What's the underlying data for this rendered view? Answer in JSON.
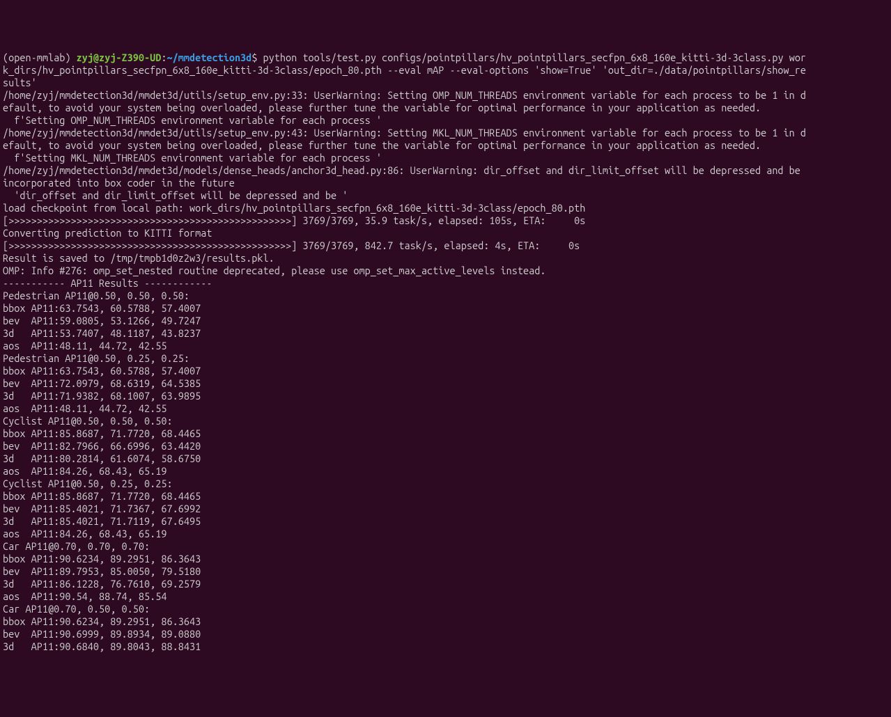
{
  "prompt": {
    "env": "(open-mmlab) ",
    "user": "zyj@zyj-Z390-UD",
    "colon": ":",
    "path": "~/mmdetection3d",
    "dollar": "$"
  },
  "command": " python tools/test.py configs/pointpillars/hv_pointpillars_secfpn_6x8_160e_kitti-3d-3class.py wor",
  "lines": [
    "k_dirs/hv_pointpillars_secfpn_6x8_160e_kitti-3d-3class/epoch_80.pth --eval mAP --eval-options 'show=True' 'out_dir=./data/pointpillars/show_re",
    "sults'",
    "/home/zyj/mmdetection3d/mmdet3d/utils/setup_env.py:33: UserWarning: Setting OMP_NUM_THREADS environment variable for each process to be 1 in d",
    "efault, to avoid your system being overloaded, please further tune the variable for optimal performance in your application as needed.",
    "  f'Setting OMP_NUM_THREADS environment variable for each process '",
    "/home/zyj/mmdetection3d/mmdet3d/utils/setup_env.py:43: UserWarning: Setting MKL_NUM_THREADS environment variable for each process to be 1 in d",
    "efault, to avoid your system being overloaded, please further tune the variable for optimal performance in your application as needed.",
    "  f'Setting MKL_NUM_THREADS environment variable for each process '",
    "/home/zyj/mmdetection3d/mmdet3d/models/dense_heads/anchor3d_head.py:86: UserWarning: dir_offset and dir_limit_offset will be depressed and be ",
    "incorporated into box coder in the future",
    "  'dir_offset and dir_limit_offset will be depressed and be '",
    "load checkpoint from local path: work_dirs/hv_pointpillars_secfpn_6x8_160e_kitti-3d-3class/epoch_80.pth",
    "[>>>>>>>>>>>>>>>>>>>>>>>>>>>>>>>>>>>>>>>>>>>>>>>>>>] 3769/3769, 35.9 task/s, elapsed: 105s, ETA:     0s",
    "Converting prediction to KITTI format",
    "[>>>>>>>>>>>>>>>>>>>>>>>>>>>>>>>>>>>>>>>>>>>>>>>>>>] 3769/3769, 842.7 task/s, elapsed: 4s, ETA:     0s",
    "Result is saved to /tmp/tmpb1d0z2w3/results.pkl.",
    "OMP: Info #276: omp_set_nested routine deprecated, please use omp_set_max_active_levels instead.",
    "",
    "",
    "----------- AP11 Results ------------",
    "",
    "Pedestrian AP11@0.50, 0.50, 0.50:",
    "bbox AP11:63.7543, 60.5788, 57.4007",
    "bev  AP11:59.0805, 53.1266, 49.7247",
    "3d   AP11:53.7407, 48.1187, 43.8237",
    "aos  AP11:48.11, 44.72, 42.55",
    "Pedestrian AP11@0.50, 0.25, 0.25:",
    "bbox AP11:63.7543, 60.5788, 57.4007",
    "bev  AP11:72.0979, 68.6319, 64.5385",
    "3d   AP11:71.9382, 68.1007, 63.9895",
    "aos  AP11:48.11, 44.72, 42.55",
    "Cyclist AP11@0.50, 0.50, 0.50:",
    "bbox AP11:85.8687, 71.7720, 68.4465",
    "bev  AP11:82.7966, 66.6996, 63.4420",
    "3d   AP11:80.2814, 61.6074, 58.6750",
    "aos  AP11:84.26, 68.43, 65.19",
    "Cyclist AP11@0.50, 0.25, 0.25:",
    "bbox AP11:85.8687, 71.7720, 68.4465",
    "bev  AP11:85.4021, 71.7367, 67.6992",
    "3d   AP11:85.4021, 71.7119, 67.6495",
    "aos  AP11:84.26, 68.43, 65.19",
    "Car AP11@0.70, 0.70, 0.70:",
    "bbox AP11:90.6234, 89.2951, 86.3643",
    "bev  AP11:89.7953, 85.0050, 79.5180",
    "3d   AP11:86.1228, 76.7610, 69.2579",
    "aos  AP11:90.54, 88.74, 85.54",
    "Car AP11@0.70, 0.50, 0.50:",
    "bbox AP11:90.6234, 89.2951, 86.3643",
    "bev  AP11:90.6999, 89.8934, 89.0880",
    "3d   AP11:90.6840, 89.8043, 88.8431"
  ]
}
